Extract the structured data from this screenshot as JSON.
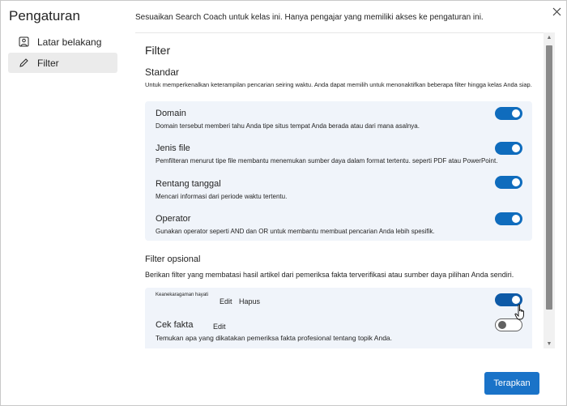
{
  "dialog": {
    "title": "Pengaturan",
    "description": "Sesuaikan Search Coach untuk kelas ini. Hanya pengajar yang memiliki akses ke pengaturan ini.",
    "close_icon": "close-icon",
    "apply_label": "Terapkan"
  },
  "nav": {
    "items": [
      {
        "label": "Latar belakang",
        "icon": "image-icon"
      },
      {
        "label": "Filter",
        "icon": "pencil-icon",
        "active": true
      }
    ]
  },
  "filter": {
    "heading": "Filter",
    "standard": {
      "title": "Standar",
      "description": "Untuk memperkenalkan keterampilan pencarian seiring waktu. Anda dapat memilih untuk menonaktifkan beberapa filter hingga kelas Anda siap.",
      "items": [
        {
          "name": "Domain",
          "description": "Domain tersebut memberi tahu Anda tipe situs tempat Anda berada atau dari mana asalnya.",
          "enabled": true
        },
        {
          "name": "Jenis file",
          "description": "Pemfilteran menurut tipe file membantu menemukan sumber daya dalam format tertentu. seperti PDF atau PowerPoint.",
          "enabled": true
        },
        {
          "name": "Rentang tanggal",
          "description": "Mencari informasi dari periode waktu tertentu.",
          "enabled": true
        },
        {
          "name": "Operator",
          "description": "Gunakan operator seperti AND dan OR untuk membantu membuat pencarian Anda lebih spesifik.",
          "enabled": true
        }
      ]
    },
    "optional": {
      "title": "Filter opsional",
      "description": "Berikan filter yang membatasi hasil artikel dari pemeriksa fakta terverifikasi atau sumber daya pilihan Anda sendiri.",
      "items": [
        {
          "name": "Keanekaragaman hayati",
          "edit_label": "Edit",
          "delete_label": "Hapus",
          "enabled": true
        },
        {
          "name": "Cek fakta",
          "edit_label": "Edit",
          "description": "Temukan apa yang dikatakan pemeriksa fakta profesional tentang topik Anda.",
          "enabled": false
        }
      ]
    }
  },
  "colors": {
    "accent": "#0f6cbd",
    "apply_button": "#1a73c8",
    "card_background": "#f0f4fa"
  }
}
